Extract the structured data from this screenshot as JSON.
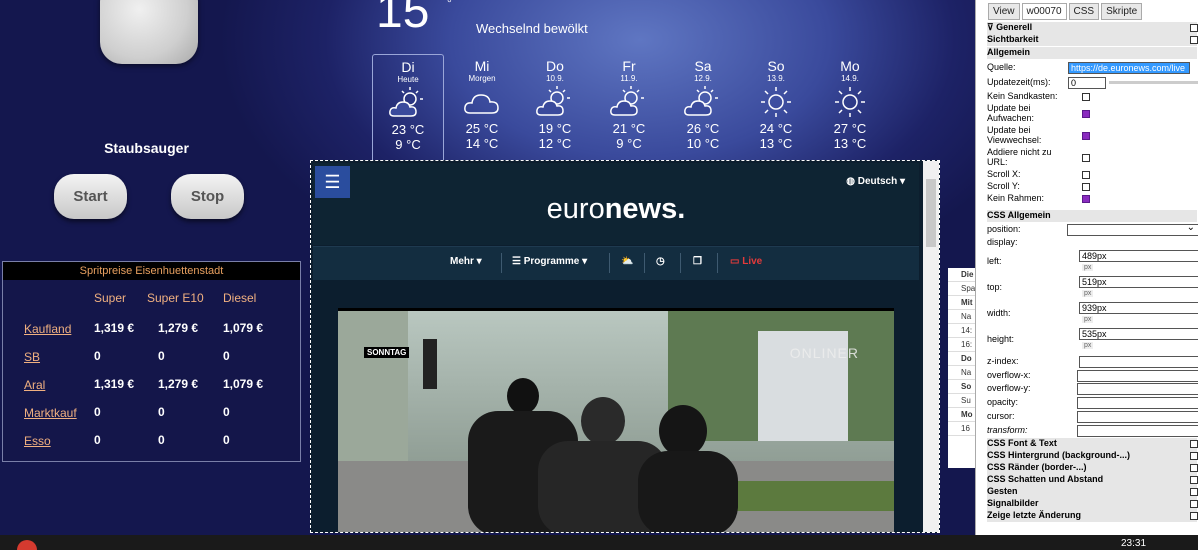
{
  "vacuum": {
    "title": "Staubsauger",
    "start": "Start",
    "stop": "Stop"
  },
  "fuel": {
    "title": "Spritpreise Eisenhuettenstadt",
    "columns": [
      "Super",
      "Super E10",
      "Diesel"
    ],
    "rows": [
      {
        "station": "Kaufland",
        "super": "1,319 €",
        "e10": "1,279 €",
        "diesel": "1,079 €"
      },
      {
        "station": "SB",
        "super": "0",
        "e10": "0",
        "diesel": "0"
      },
      {
        "station": "Aral",
        "super": "1,319 €",
        "e10": "1,279 €",
        "diesel": "1,079 €"
      },
      {
        "station": "Marktkauf",
        "super": "0",
        "e10": "0",
        "diesel": "0"
      },
      {
        "station": "Esso",
        "super": "0",
        "e10": "0",
        "diesel": "0"
      }
    ]
  },
  "weather": {
    "current_temp": "15",
    "current_unit": "°",
    "condition": "Wechselnd bewölkt",
    "days": [
      {
        "name": "Di",
        "date": "Heute",
        "hi": "23 °C",
        "lo": "9 °C",
        "icon": "partly-sunny-icon"
      },
      {
        "name": "Mi",
        "date": "Morgen",
        "hi": "25 °C",
        "lo": "14 °C",
        "icon": "cloud-icon"
      },
      {
        "name": "Do",
        "date": "10.9.",
        "hi": "19 °C",
        "lo": "12 °C",
        "icon": "partly-sunny-icon"
      },
      {
        "name": "Fr",
        "date": "11.9.",
        "hi": "21 °C",
        "lo": "9 °C",
        "icon": "sun-cloud-icon"
      },
      {
        "name": "Sa",
        "date": "12.9.",
        "hi": "26 °C",
        "lo": "10 °C",
        "icon": "sun-cloud-icon"
      },
      {
        "name": "So",
        "date": "13.9.",
        "hi": "24 °C",
        "lo": "13 °C",
        "icon": "sun-icon"
      },
      {
        "name": "Mo",
        "date": "14.9.",
        "hi": "27 °C",
        "lo": "13 °C",
        "icon": "sun-icon"
      }
    ]
  },
  "euronews": {
    "lang": "Deutsch",
    "logo_light": "euro",
    "logo_bold": "news.",
    "nav": {
      "more": "Mehr",
      "programs": "Programme",
      "live": "Live"
    },
    "badge": "SONNTAG",
    "channel": "ONLINER"
  },
  "side_widget": [
    "Die",
    "Spa",
    "Mit",
    "Na",
    "14:",
    "16:",
    "Do",
    "Na",
    "So",
    "Su",
    "Mo",
    "16"
  ],
  "panel": {
    "tabs": [
      "View",
      "w00070",
      "CSS",
      "Skripte"
    ],
    "sections": {
      "generell": "Generell",
      "sichtbarkeit": "Sichtbarkeit",
      "allgemein": "Allgemein",
      "css_allgemein": "CSS Allgemein",
      "css_font": "CSS Font & Text",
      "css_bg": "CSS Hintergrund (background-...)",
      "css_border": "CSS Ränder (border-...)",
      "css_shadow": "CSS Schatten und Abstand",
      "gesten": "Gesten",
      "signalbilder": "Signalbilder",
      "last_change": "Zeige letzte Änderung"
    },
    "fields": {
      "quelle_label": "Quelle:",
      "quelle_value": "https://de.euronews.com/live",
      "update_label": "Updatezeit(ms):",
      "update_value": "0",
      "sandbox": "Kein Sandkasten:",
      "wake": "Update bei Aufwachen:",
      "view": "Update bei Viewwechsel:",
      "noadd": "Addiere nicht zu URL:",
      "scrollx": "Scroll X:",
      "scrolly": "Scroll Y:",
      "noframe": "Kein Rahmen:",
      "position": "position:",
      "display": "display:",
      "left_label": "left:",
      "left_value": "489px",
      "top_label": "top:",
      "top_value": "519px",
      "width_label": "width:",
      "width_value": "939px",
      "height_label": "height:",
      "height_value": "535px",
      "unit": "px",
      "zindex": "z-index:",
      "overflowx": "overflow-x:",
      "overflowy": "overflow-y:",
      "opacity": "opacity:",
      "cursor": "cursor:",
      "transform": "transform:"
    }
  },
  "taskbar": {
    "time": "23:31"
  }
}
